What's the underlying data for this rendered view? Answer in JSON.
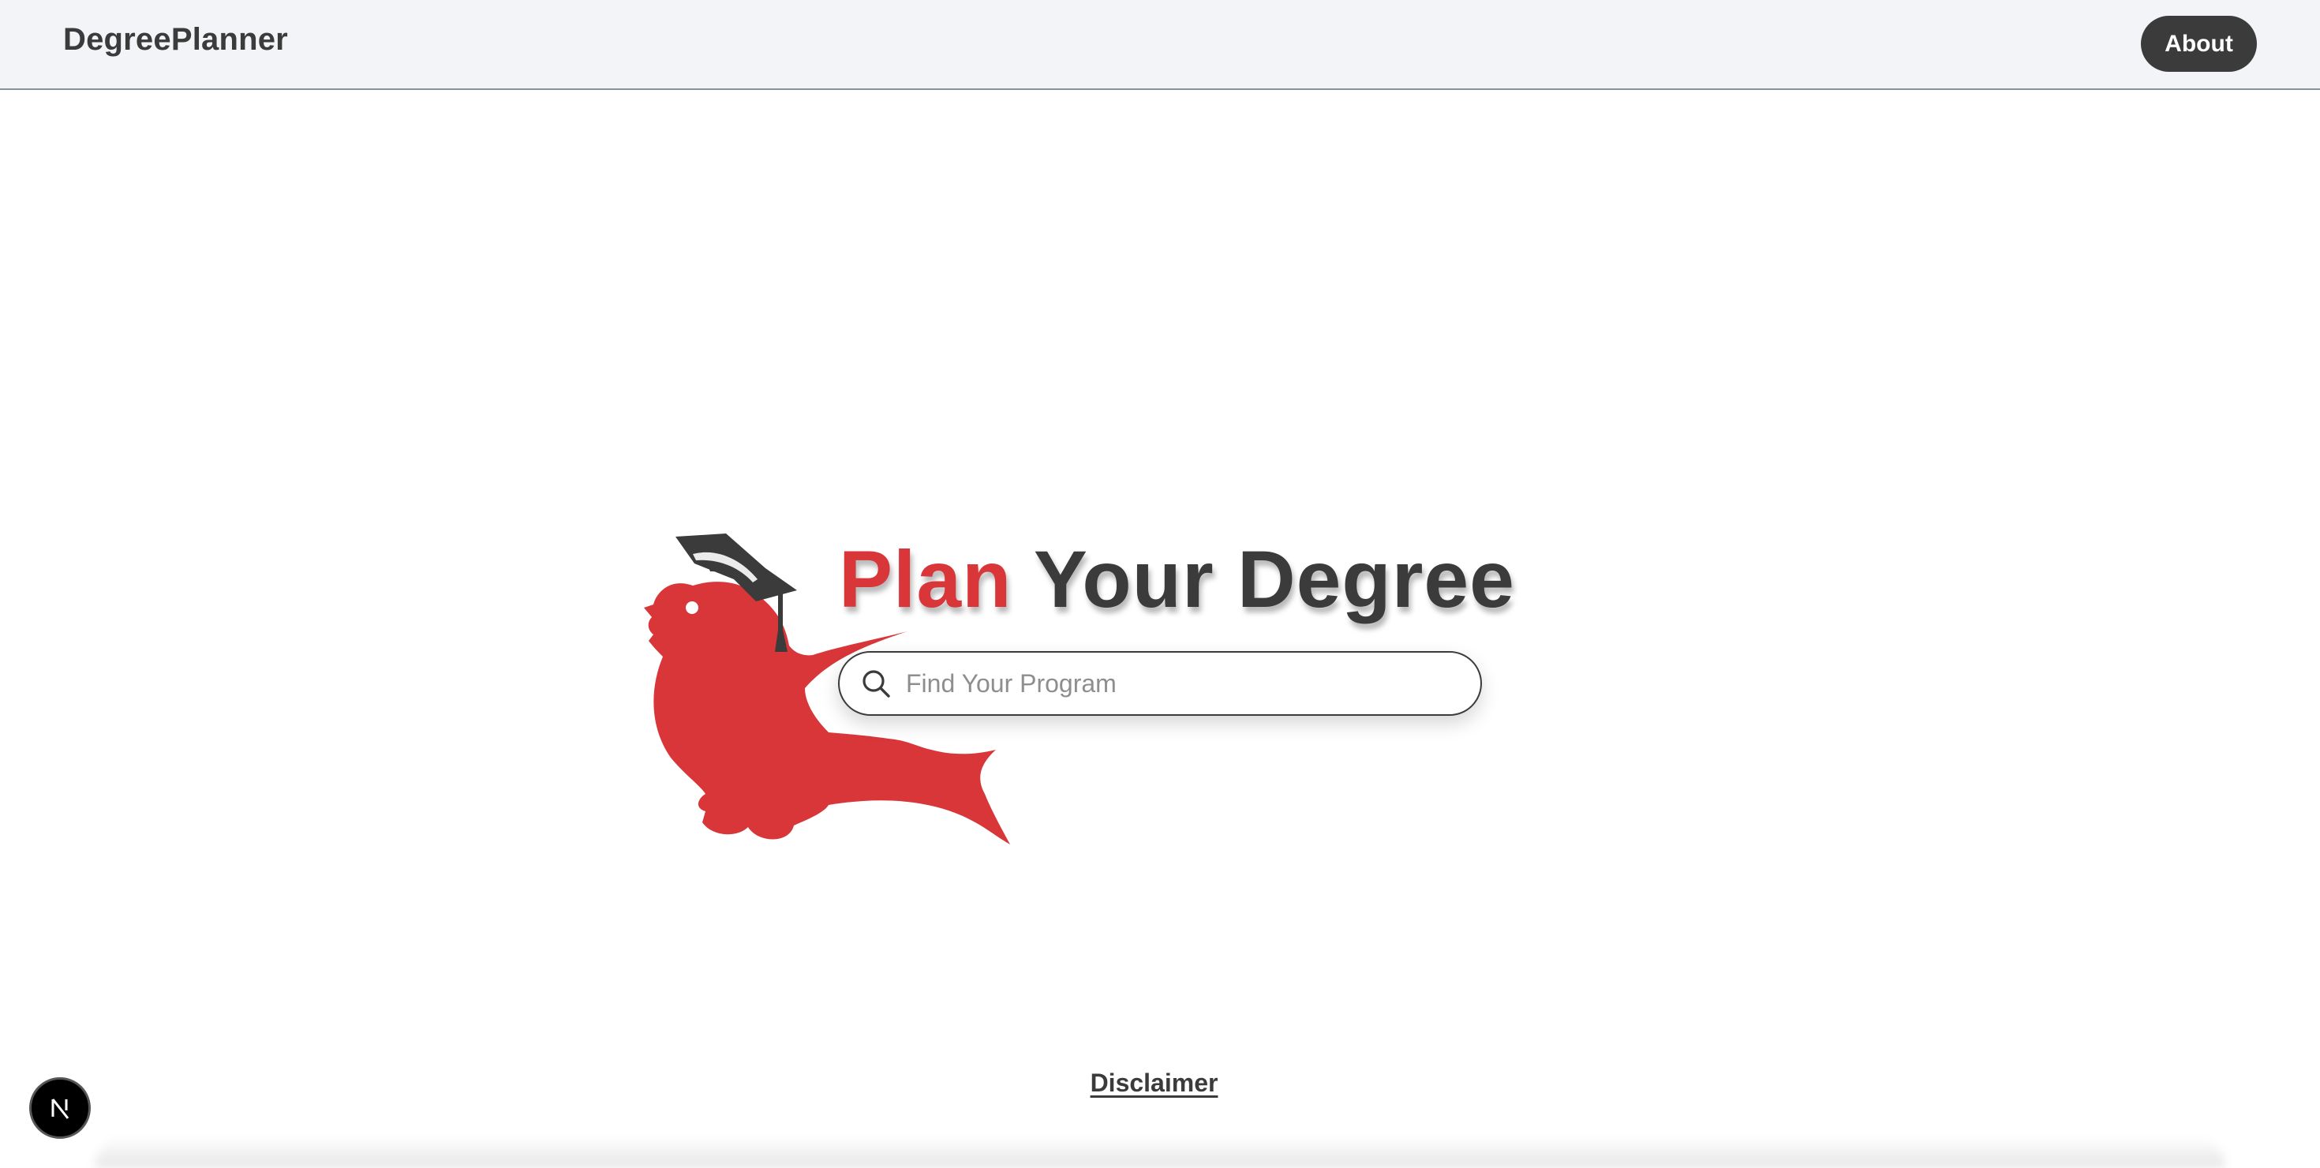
{
  "header": {
    "brand": "DegreePlanner",
    "about_label": "About"
  },
  "hero": {
    "title_accent": "Plan",
    "title_rest": "Your Degree",
    "search_placeholder": "Find Your Program",
    "search_value": ""
  },
  "footer": {
    "disclaimer_label": "Disclaimer",
    "dev_badge_icon": "nextjs-icon"
  },
  "colors": {
    "accent_red": "#d83639",
    "dark": "#3b3b3b",
    "header_bg": "#f3f4f7"
  },
  "icons": {
    "search": "search-icon",
    "mascot": "cardinal-mascot-with-graduation-cap"
  }
}
